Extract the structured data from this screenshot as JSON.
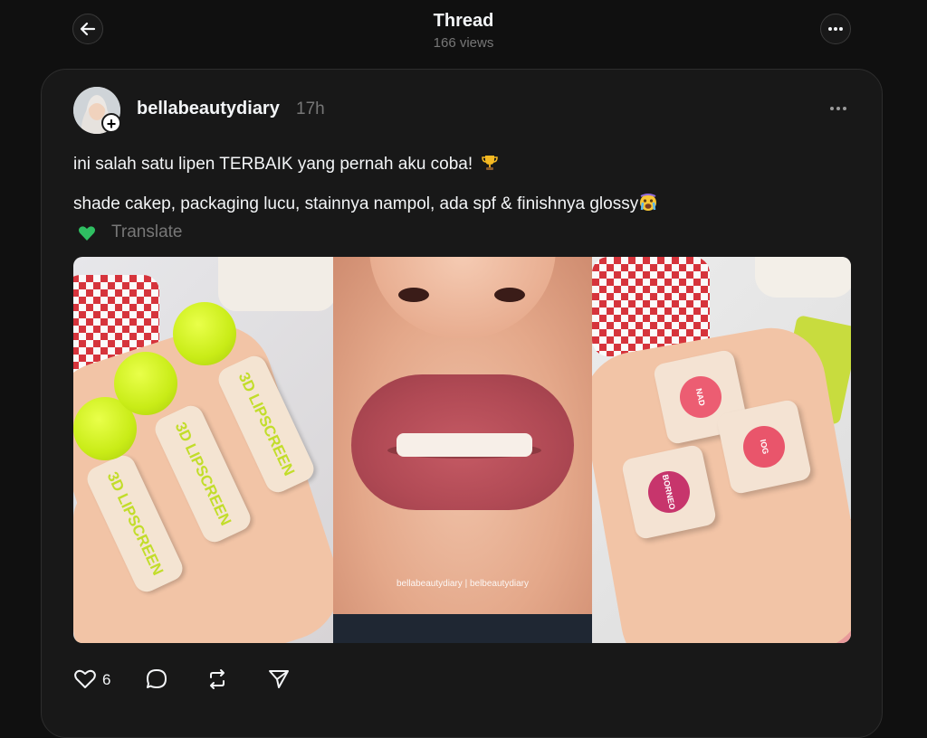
{
  "header": {
    "title": "Thread",
    "views": "166 views",
    "back_icon": "arrow-left-icon",
    "more_icon": "ellipsis-icon"
  },
  "post": {
    "username": "bellabeautydiary",
    "timestamp": "17h",
    "follow_icon": "plus-icon",
    "text_line1": "ini salah satu lipen TERBAIK yang pernah aku coba!",
    "text_line1_emoji": "trophy-emoji",
    "text_line2": "shade cakep, packaging lucu, stainnya nampol, ada spf & finishnya glossy",
    "text_line2_emoji": "crying-face-emoji",
    "translate_emoji": "green-heart-emoji",
    "translate_label": "Translate",
    "images": [
      {
        "product_label": "3D LIPSCREEN"
      },
      {
        "watermark": "bellabeautydiary | belbeautydiary"
      },
      {
        "cube_labels": [
          "NAD",
          "IOG",
          "BORNEO"
        ]
      }
    ],
    "actions": {
      "like_count": "6",
      "icons": [
        "heart-icon",
        "comment-icon",
        "repost-icon",
        "share-icon"
      ]
    }
  },
  "colors": {
    "background": "#101010",
    "card": "#181818",
    "text_primary": "#f3f5f7",
    "text_secondary": "#777777"
  }
}
